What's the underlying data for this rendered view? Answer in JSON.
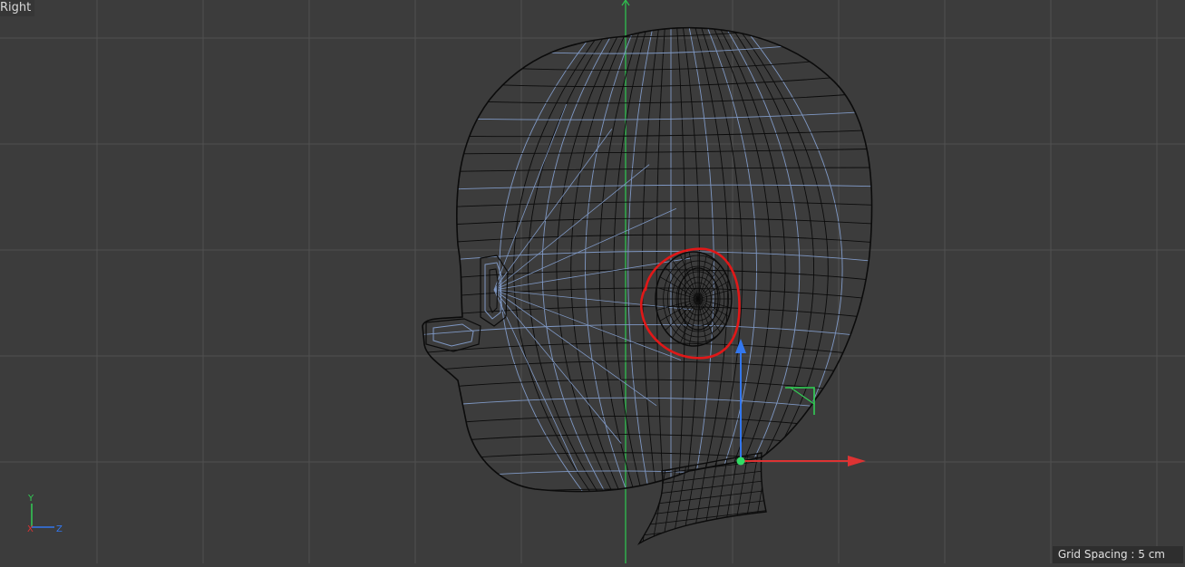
{
  "viewport": {
    "view_name": "Right",
    "grid_spacing_label": "Grid Spacing : 5 cm"
  },
  "axis_gizmo": {
    "y_label": "Y",
    "x_label": "X",
    "z_label": "Z"
  },
  "colors": {
    "background": "#3c3c3c",
    "grid_line": "#505050",
    "wire_black": "#0b0b0b",
    "wire_blue": "#7f98c4",
    "axis_green": "#33cc55",
    "axis_red": "#dd3333",
    "axis_blue": "#3377ee",
    "annotation_red": "#e01818"
  }
}
